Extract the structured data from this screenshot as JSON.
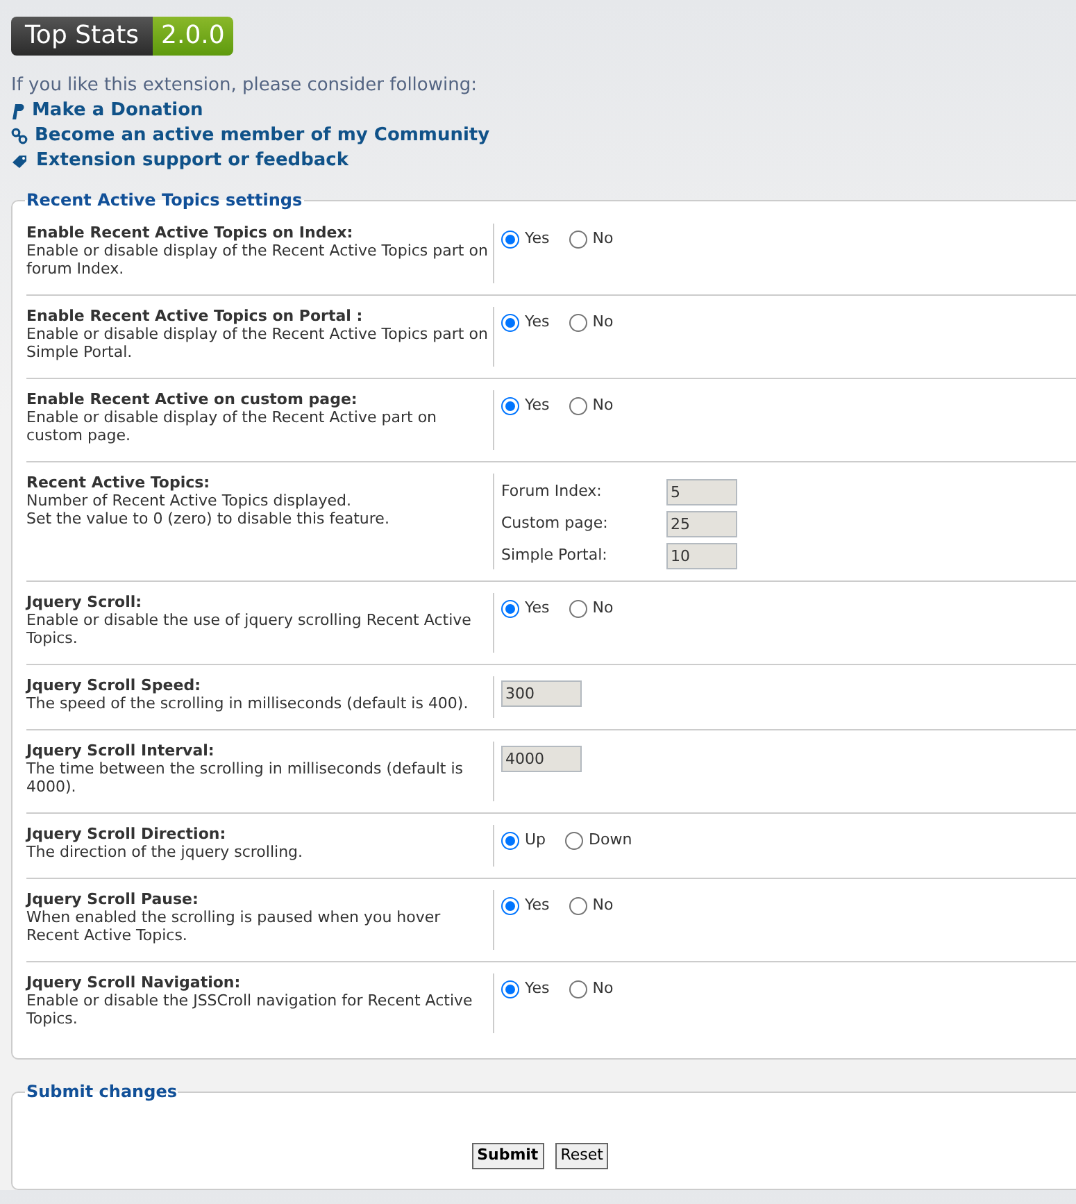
{
  "badge": {
    "name": "Top Stats",
    "version": "2.0.0"
  },
  "intro": "If you like this extension, please consider following:",
  "links": [
    {
      "kind": "donate",
      "label": "Make a Donation"
    },
    {
      "kind": "community",
      "label": "Become an active member of my Community"
    },
    {
      "kind": "support",
      "label": "Extension support or feedback"
    }
  ],
  "settings": {
    "legend": "Recent Active Topics settings",
    "rows": [
      {
        "kind": "radio",
        "title": "Enable Recent Active Topics on Index:",
        "description": "Enable or disable display of the Recent Active Topics part on forum Index.",
        "options": [
          {
            "label": "Yes",
            "selected": true
          },
          {
            "label": "No",
            "selected": false
          }
        ]
      },
      {
        "kind": "radio",
        "title": "Enable Recent Active Topics on Portal :",
        "description": "Enable or disable display of the Recent Active Topics part on Simple Portal.",
        "options": [
          {
            "label": "Yes",
            "selected": true
          },
          {
            "label": "No",
            "selected": false
          }
        ]
      },
      {
        "kind": "radio",
        "title": "Enable Recent Active on custom page:",
        "description": "Enable or disable display of the Recent Active part on custom page.",
        "options": [
          {
            "label": "Yes",
            "selected": true
          },
          {
            "label": "No",
            "selected": false
          }
        ]
      },
      {
        "kind": "inputs",
        "title": "Recent Active Topics:",
        "description": "Number of Recent Active Topics displayed.\nSet the value to 0 (zero) to disable this feature.",
        "fields": [
          {
            "label": "Forum Index:",
            "value": "5"
          },
          {
            "label": "Custom page:",
            "value": "25"
          },
          {
            "label": "Simple Portal:",
            "value": "10"
          }
        ]
      },
      {
        "kind": "radio",
        "title": "Jquery Scroll:",
        "description": "Enable or disable the use of jquery scrolling Recent Active Topics.",
        "options": [
          {
            "label": "Yes",
            "selected": true
          },
          {
            "label": "No",
            "selected": false
          }
        ]
      },
      {
        "kind": "input",
        "title": "Jquery Scroll Speed:",
        "description": "The speed of the scrolling in milliseconds (default is 400).",
        "value": "300"
      },
      {
        "kind": "input",
        "title": "Jquery Scroll Interval:",
        "description": "The time between the scrolling in milliseconds (default is 4000).",
        "value": "4000"
      },
      {
        "kind": "radio",
        "title": "Jquery Scroll Direction:",
        "description": "The direction of the jquery scrolling.",
        "options": [
          {
            "label": "Up",
            "selected": true
          },
          {
            "label": "Down",
            "selected": false
          }
        ]
      },
      {
        "kind": "radio",
        "title": "Jquery Scroll Pause:",
        "description": "When enabled the scrolling is paused when you hover Recent Active Topics.",
        "options": [
          {
            "label": "Yes",
            "selected": true
          },
          {
            "label": "No",
            "selected": false
          }
        ]
      },
      {
        "kind": "radio",
        "title": "Jquery Scroll Navigation:",
        "description": "Enable or disable the JSSCroll navigation for Recent Active Topics.",
        "options": [
          {
            "label": "Yes",
            "selected": true
          },
          {
            "label": "No",
            "selected": false
          }
        ]
      }
    ]
  },
  "submit": {
    "legend": "Submit changes",
    "buttons": [
      {
        "kind": "submit",
        "label": "Submit"
      },
      {
        "kind": "reset",
        "label": "Reset"
      }
    ]
  }
}
